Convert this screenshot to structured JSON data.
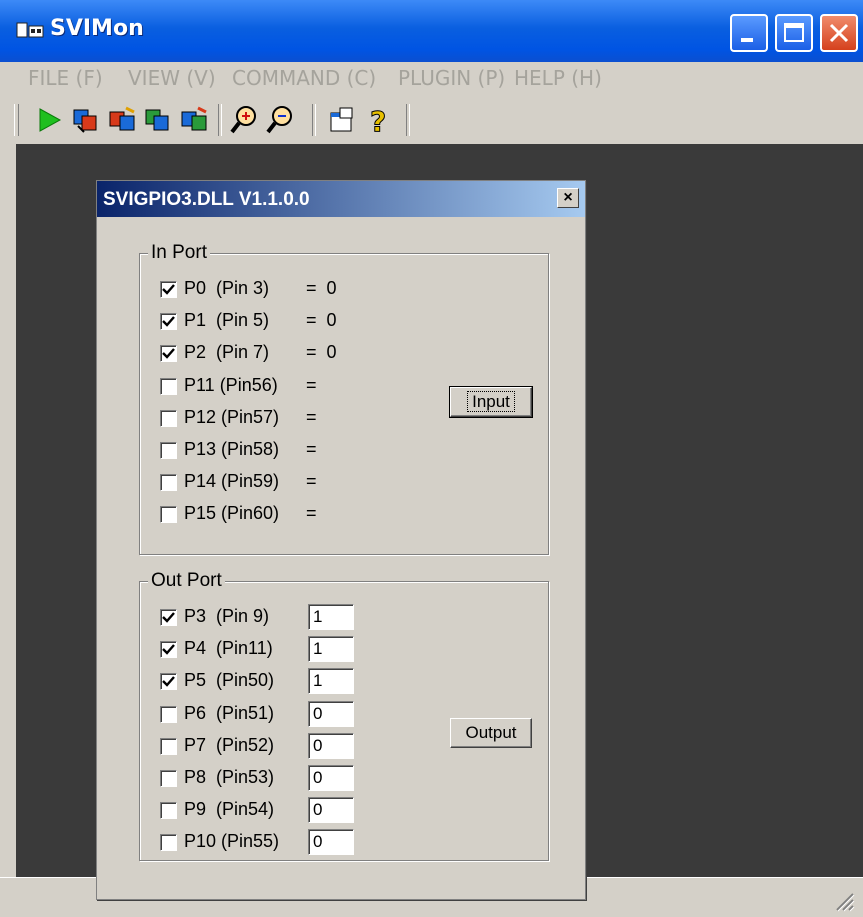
{
  "app": {
    "title": "SVIMon"
  },
  "menu": [
    {
      "label": "FILE (F)"
    },
    {
      "label": "VIEW (V)"
    },
    {
      "label": "COMMAND (C)"
    },
    {
      "label": "PLUGIN (P)"
    },
    {
      "label": "HELP (H)"
    }
  ],
  "toolbar": {
    "icons": [
      "run-icon",
      "connect-icon",
      "disconnect-icon",
      "read-icon",
      "write-icon",
      "zoom-in-icon",
      "zoom-out-icon",
      "properties-icon",
      "help-icon"
    ]
  },
  "dialog": {
    "title": "SVIGPIO3.DLL V1.1.0.0",
    "close_glyph": "×",
    "in_port": {
      "label": "In Port",
      "button": "Input",
      "rows": [
        {
          "name": "P0  (Pin 3)",
          "checked": true,
          "value": "=  0"
        },
        {
          "name": "P1  (Pin 5)",
          "checked": true,
          "value": "=  0"
        },
        {
          "name": "P2  (Pin 7)",
          "checked": true,
          "value": "=  0"
        },
        {
          "name": "P11 (Pin56)",
          "checked": false,
          "value": "="
        },
        {
          "name": "P12 (Pin57)",
          "checked": false,
          "value": "="
        },
        {
          "name": "P13 (Pin58)",
          "checked": false,
          "value": "="
        },
        {
          "name": "P14 (Pin59)",
          "checked": false,
          "value": "="
        },
        {
          "name": "P15 (Pin60)",
          "checked": false,
          "value": "="
        }
      ]
    },
    "out_port": {
      "label": "Out Port",
      "button": "Output",
      "rows": [
        {
          "name": "P3  (Pin 9)",
          "checked": true,
          "value": "1"
        },
        {
          "name": "P4  (Pin11)",
          "checked": true,
          "value": "1"
        },
        {
          "name": "P5  (Pin50)",
          "checked": true,
          "value": "1"
        },
        {
          "name": "P6  (Pin51)",
          "checked": false,
          "value": "0"
        },
        {
          "name": "P7  (Pin52)",
          "checked": false,
          "value": "0"
        },
        {
          "name": "P8  (Pin53)",
          "checked": false,
          "value": "0"
        },
        {
          "name": "P9  (Pin54)",
          "checked": false,
          "value": "0"
        },
        {
          "name": "P10 (Pin55)",
          "checked": false,
          "value": "0"
        }
      ]
    }
  },
  "colors": {
    "titlebar": "#0054e3",
    "dialog_title_start": "#0a246a",
    "dialog_title_end": "#a6caf0",
    "client_bg": "#3a3a3a",
    "face": "#d4d0c8"
  }
}
